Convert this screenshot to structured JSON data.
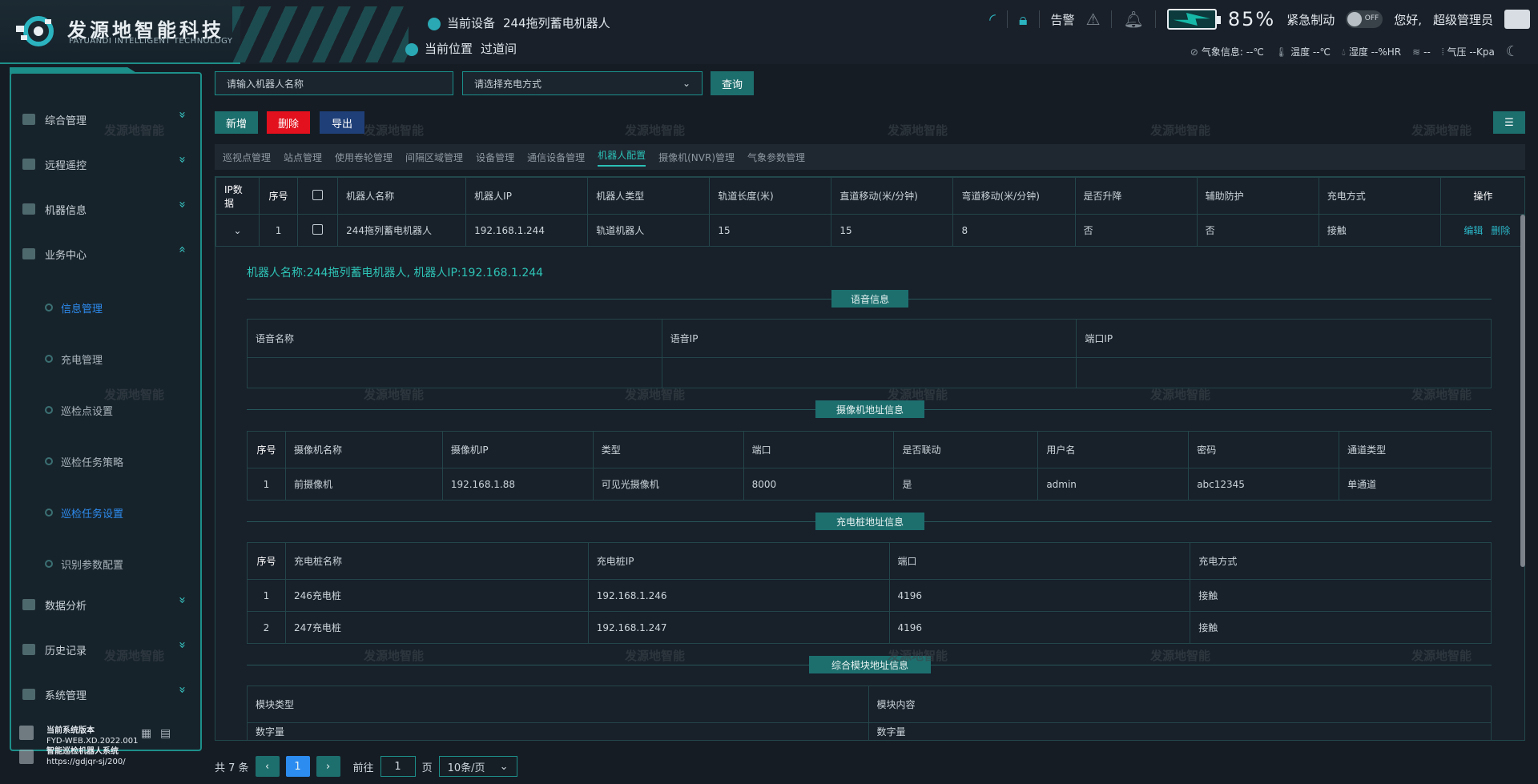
{
  "header": {
    "logo_title": "发源地智能科技",
    "logo_subtitle": "FAYUANDI INTELLIGENT TECHNOLOGY",
    "current_device_label": "当前设备",
    "current_device_value": "244拖列蓄电机器人",
    "current_location_label": "当前位置",
    "current_location_value": "过道间",
    "alarm_label": "告警",
    "battery_percent": "85%",
    "emergency_brake_label": "紧急制动",
    "toggle_label": "OFF",
    "greeting": "您好,",
    "user_name": "超级管理员",
    "weather": {
      "weather_label": "气象信息: --℃",
      "temp_label": "温度 --℃",
      "humidity_label": "湿度 --%HR",
      "wind_label": "--",
      "pressure_label": "气压 --Kpa"
    }
  },
  "sidebar": {
    "items": [
      {
        "label": "综合管理",
        "chevron": "»"
      },
      {
        "label": "远程遥控",
        "chevron": "»"
      },
      {
        "label": "机器信息",
        "chevron": "»"
      },
      {
        "label": "业务中心",
        "chevron": "«"
      },
      {
        "label": "数据分析",
        "chevron": "»"
      },
      {
        "label": "历史记录",
        "chevron": "»"
      },
      {
        "label": "系统管理",
        "chevron": "»"
      }
    ],
    "subitems": [
      {
        "label": "信息管理"
      },
      {
        "label": "充电管理"
      },
      {
        "label": "巡检点设置"
      },
      {
        "label": "巡检任务策略"
      },
      {
        "label": "巡检任务设置"
      },
      {
        "label": "识别参数配置"
      }
    ],
    "version": {
      "line1": "当前系统版本",
      "line2": "FYD-WEB.XD.2022.001",
      "line3": "智能巡检机器人系统",
      "line4": "https://gdjqr-sj/200/"
    }
  },
  "toolbar": {
    "robot_name_placeholder": "请输入机器人名称",
    "charge_mode_placeholder": "请选择充电方式",
    "query_label": "查询",
    "add_label": "新增",
    "delete_label": "删除",
    "export_label": "导出",
    "menu_icon": "☰"
  },
  "tabs": [
    "巡视点管理",
    "站点管理",
    "使用卷轮管理",
    "间隔区域管理",
    "设备管理",
    "通信设备管理",
    "机器人配置",
    "摄像机(NVR)管理",
    "气象参数管理"
  ],
  "table": {
    "headers": [
      "IP数据",
      "序号",
      "",
      "机器人名称",
      "机器人IP",
      "机器人类型",
      "轨道长度(米)",
      "直道移动(米/分钟)",
      "弯道移动(米/分钟)",
      "是否升降",
      "辅助防护",
      "充电方式",
      "操作"
    ],
    "row": {
      "expand": "⌄",
      "index": "1",
      "name": "244拖列蓄电机器人",
      "ip": "192.168.1.244",
      "type": "轨道机器人",
      "length": "15",
      "straight": "15",
      "curve": "8",
      "lift": "否",
      "protect": "否",
      "charge": "接触",
      "edit": "编辑",
      "delete": "删除"
    }
  },
  "detail": {
    "caption": "机器人名称:244拖列蓄电机器人, 机器人IP:192.168.1.244",
    "voice_title": "语音信息",
    "voice_headers": [
      "语音名称",
      "语音IP",
      "端口IP"
    ],
    "camera_title": "摄像机地址信息",
    "camera_headers": [
      "序号",
      "摄像机名称",
      "摄像机IP",
      "类型",
      "端口",
      "是否联动",
      "用户名",
      "密码",
      "通道类型"
    ],
    "camera_row": [
      "1",
      "前摄像机",
      "192.168.1.88",
      "可见光摄像机",
      "8000",
      "是",
      "admin",
      "abc12345",
      "单通道"
    ],
    "charge_title": "充电桩地址信息",
    "charge_headers": [
      "序号",
      "充电桩名称",
      "充电桩IP",
      "端口",
      "充电方式"
    ],
    "charge_rows": [
      [
        "1",
        "246充电桩",
        "192.168.1.246",
        "4196",
        "接触"
      ],
      [
        "2",
        "247充电桩",
        "192.168.1.247",
        "4196",
        "接触"
      ]
    ],
    "module_title": "综合模块地址信息",
    "module_headers": [
      "模块类型",
      "模块内容"
    ],
    "module_row": [
      "数字量",
      "数字量"
    ]
  },
  "watermark": "发源地智能",
  "pager": {
    "total": "共 7 条",
    "prev": "‹",
    "current": "1",
    "next": "›",
    "goto_label": "前往",
    "goto_value": "1",
    "page_label": "页",
    "size": "10条/页"
  }
}
